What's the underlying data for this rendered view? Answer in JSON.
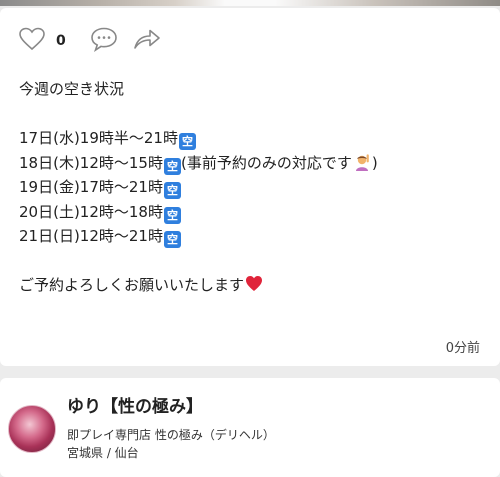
{
  "post": {
    "like_count": "0",
    "lines": [
      "今週の空き状況",
      "",
      "17日(水)19時半〜21時",
      "18日(木)12時〜15時",
      "19日(金)17時〜21時",
      "20日(土)12時〜18時",
      "21日(日)12時〜21時",
      "",
      "ご予約よろしくお願いいたします"
    ],
    "vacant_label": "空",
    "line2_note": "(事前予約のみの対応です",
    "line2_note_close": ")",
    "timestamp": "0分前"
  },
  "profile": {
    "name": "ゆり【性の極み】",
    "shop": "即プレイ専門店 性の極み（デリヘル）",
    "location": "宮城県 / 仙台"
  },
  "icons": {
    "like": "heart-outline-icon",
    "comment": "speech-bubble-icon",
    "share": "share-arrow-icon"
  }
}
